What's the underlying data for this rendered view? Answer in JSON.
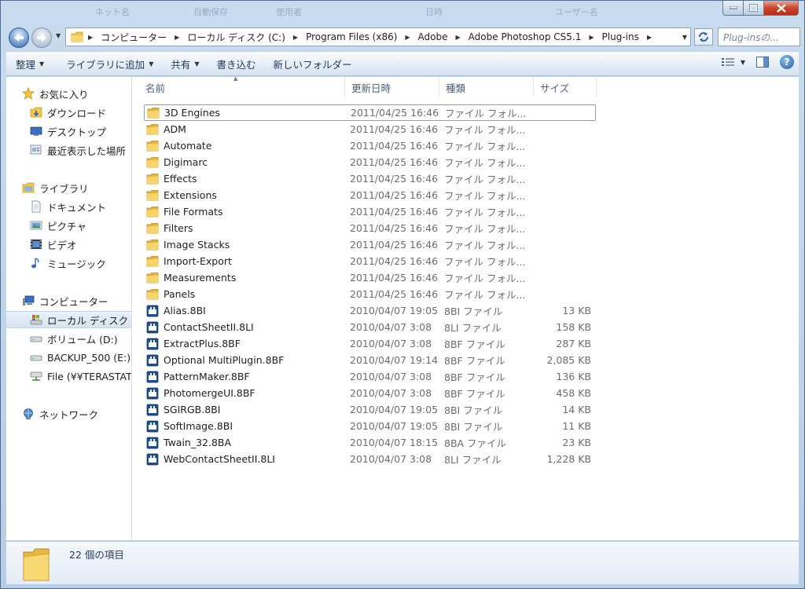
{
  "background_tabs": [
    "ネット名",
    "自動保存",
    "使用者",
    "日時",
    "ユーザー名"
  ],
  "window_controls": {
    "minimize": "─",
    "maximize": "□",
    "close": "✕"
  },
  "address_bar": {
    "breadcrumbs": [
      "コンピューター",
      "ローカル ディスク (C:)",
      "Program Files (x86)",
      "Adobe",
      "Adobe Photoshop CS5.1",
      "Plug-ins"
    ]
  },
  "search": {
    "placeholder": "Plug-insの..."
  },
  "toolbar": {
    "organize": "整理",
    "add_to_library": "ライブラリに追加",
    "share": "共有",
    "burn": "書き込む",
    "new_folder": "新しいフォルダー"
  },
  "nav_pane": {
    "favorites": {
      "label": "お気に入り",
      "items": [
        "ダウンロード",
        "デスクトップ",
        "最近表示した場所"
      ]
    },
    "libraries": {
      "label": "ライブラリ",
      "items": [
        "ドキュメント",
        "ピクチャ",
        "ビデオ",
        "ミュージック"
      ]
    },
    "computer": {
      "label": "コンピューター",
      "items": [
        "ローカル ディスク (C:)",
        "ボリューム (D:)",
        "BACKUP_500 (E:)",
        "File (¥¥TERASTATION)"
      ]
    },
    "network": {
      "label": "ネットワーク"
    }
  },
  "columns": {
    "name": "名前",
    "date": "更新日時",
    "type": "種類",
    "size": "サイズ"
  },
  "files": [
    {
      "name": "3D Engines",
      "date": "2011/04/25 16:46",
      "type": "ファイル フォル...",
      "size": "",
      "kind": "folder"
    },
    {
      "name": "ADM",
      "date": "2011/04/25 16:46",
      "type": "ファイル フォル...",
      "size": "",
      "kind": "folder"
    },
    {
      "name": "Automate",
      "date": "2011/04/25 16:46",
      "type": "ファイル フォル...",
      "size": "",
      "kind": "folder"
    },
    {
      "name": "Digimarc",
      "date": "2011/04/25 16:46",
      "type": "ファイル フォル...",
      "size": "",
      "kind": "folder"
    },
    {
      "name": "Effects",
      "date": "2011/04/25 16:46",
      "type": "ファイル フォル...",
      "size": "",
      "kind": "folder"
    },
    {
      "name": "Extensions",
      "date": "2011/04/25 16:46",
      "type": "ファイル フォル...",
      "size": "",
      "kind": "folder"
    },
    {
      "name": "File Formats",
      "date": "2011/04/25 16:46",
      "type": "ファイル フォル...",
      "size": "",
      "kind": "folder"
    },
    {
      "name": "Filters",
      "date": "2011/04/25 16:46",
      "type": "ファイル フォル...",
      "size": "",
      "kind": "folder"
    },
    {
      "name": "Image Stacks",
      "date": "2011/04/25 16:46",
      "type": "ファイル フォル...",
      "size": "",
      "kind": "folder"
    },
    {
      "name": "Import-Export",
      "date": "2011/04/25 16:46",
      "type": "ファイル フォル...",
      "size": "",
      "kind": "folder"
    },
    {
      "name": "Measurements",
      "date": "2011/04/25 16:46",
      "type": "ファイル フォル...",
      "size": "",
      "kind": "folder"
    },
    {
      "name": "Panels",
      "date": "2011/04/25 16:46",
      "type": "ファイル フォル...",
      "size": "",
      "kind": "folder"
    },
    {
      "name": "Alias.8BI",
      "date": "2010/04/07 19:05",
      "type": "8BI ファイル",
      "size": "13 KB",
      "kind": "file"
    },
    {
      "name": "ContactSheetII.8LI",
      "date": "2010/04/07 3:08",
      "type": "8LI ファイル",
      "size": "158 KB",
      "kind": "file"
    },
    {
      "name": "ExtractPlus.8BF",
      "date": "2010/04/07 3:08",
      "type": "8BF ファイル",
      "size": "287 KB",
      "kind": "file"
    },
    {
      "name": "Optional MultiPlugin.8BF",
      "date": "2010/04/07 19:14",
      "type": "8BF ファイル",
      "size": "2,085 KB",
      "kind": "file"
    },
    {
      "name": "PatternMaker.8BF",
      "date": "2010/04/07 3:08",
      "type": "8BF ファイル",
      "size": "136 KB",
      "kind": "file"
    },
    {
      "name": "PhotomergeUI.8BF",
      "date": "2010/04/07 3:08",
      "type": "8BF ファイル",
      "size": "458 KB",
      "kind": "file"
    },
    {
      "name": "SGIRGB.8BI",
      "date": "2010/04/07 19:05",
      "type": "8BI ファイル",
      "size": "14 KB",
      "kind": "file"
    },
    {
      "name": "SoftImage.8BI",
      "date": "2010/04/07 19:05",
      "type": "8BI ファイル",
      "size": "11 KB",
      "kind": "file"
    },
    {
      "name": "Twain_32.8BA",
      "date": "2010/04/07 18:15",
      "type": "8BA ファイル",
      "size": "23 KB",
      "kind": "file"
    },
    {
      "name": "WebContactSheetII.8LI",
      "date": "2010/04/07 3:08",
      "type": "8LI ファイル",
      "size": "1,228 KB",
      "kind": "file"
    }
  ],
  "status": {
    "item_count": "22 個の項目"
  },
  "colors": {
    "folder": "#f2c649",
    "accent": "#1f5aa8",
    "selection": "#d6e3f1"
  }
}
